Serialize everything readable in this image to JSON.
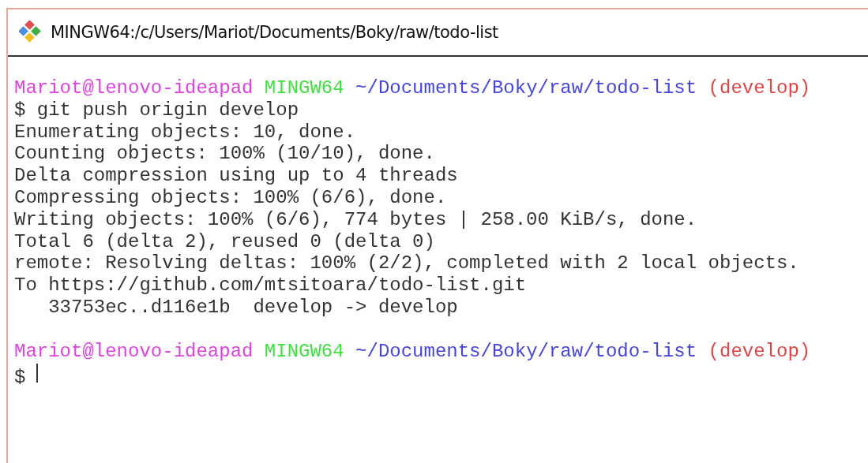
{
  "window": {
    "title": "MINGW64:/c/Users/Mariot/Documents/Boky/raw/todo-list"
  },
  "terminal": {
    "lines": [
      {
        "kind": "prompt",
        "user": "Mariot@lenovo-ideapad",
        "system": "MINGW64",
        "path": "~/Documents/Boky/raw/todo-list",
        "branch": "(develop)"
      },
      {
        "kind": "command",
        "text": "$ git push origin develop"
      },
      {
        "kind": "output",
        "text": "Enumerating objects: 10, done."
      },
      {
        "kind": "output",
        "text": "Counting objects: 100% (10/10), done."
      },
      {
        "kind": "output",
        "text": "Delta compression using up to 4 threads"
      },
      {
        "kind": "output",
        "text": "Compressing objects: 100% (6/6), done."
      },
      {
        "kind": "output",
        "text": "Writing objects: 100% (6/6), 774 bytes | 258.00 KiB/s, done."
      },
      {
        "kind": "output",
        "text": "Total 6 (delta 2), reused 0 (delta 0)"
      },
      {
        "kind": "output",
        "text": "remote: Resolving deltas: 100% (2/2), completed with 2 local objects."
      },
      {
        "kind": "output",
        "text": "To https://github.com/mtsitoara/todo-list.git"
      },
      {
        "kind": "output",
        "text": "   33753ec..d116e1b  develop -> develop"
      },
      {
        "kind": "blank"
      },
      {
        "kind": "prompt",
        "user": "Mariot@lenovo-ideapad",
        "system": "MINGW64",
        "path": "~/Documents/Boky/raw/todo-list",
        "branch": "(develop)"
      },
      {
        "kind": "input",
        "text": "$"
      }
    ]
  }
}
